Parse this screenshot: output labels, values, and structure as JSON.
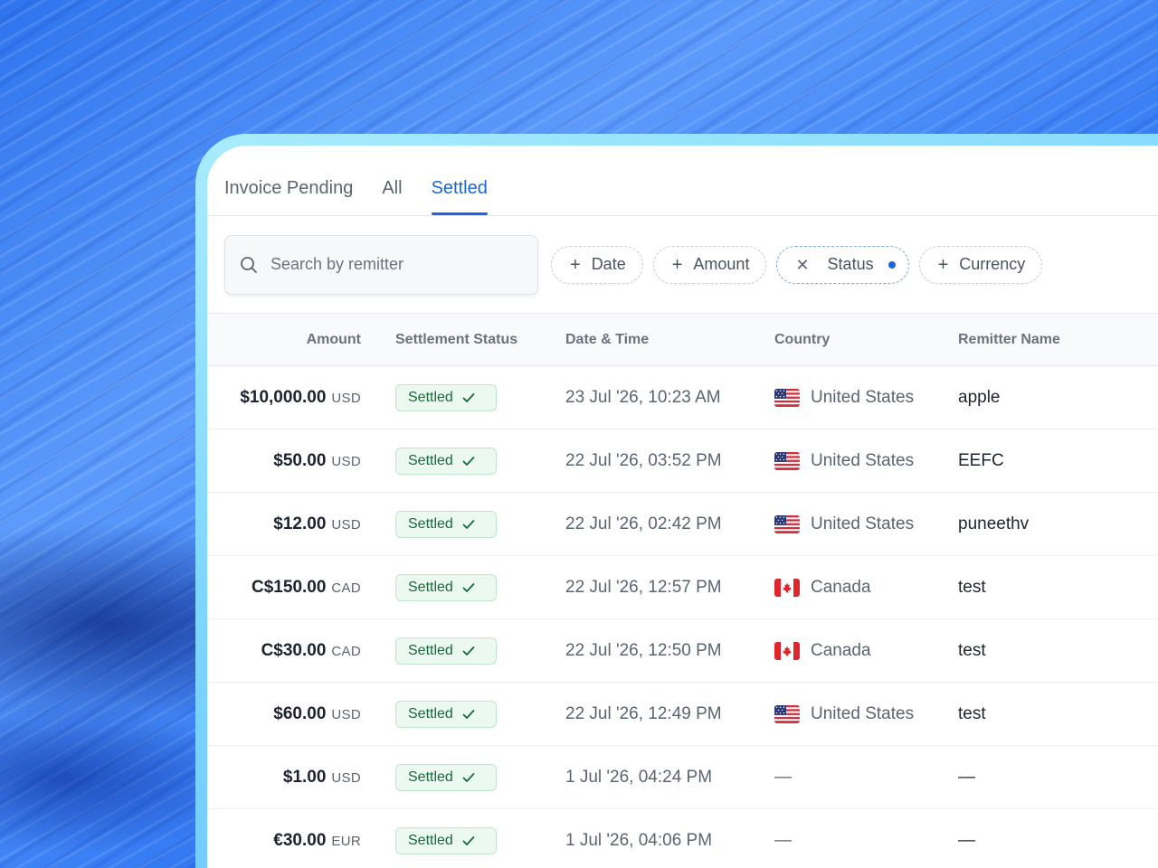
{
  "tabs": [
    {
      "label": "Invoice Pending",
      "active": false
    },
    {
      "label": "All",
      "active": false
    },
    {
      "label": "Settled",
      "active": true
    }
  ],
  "search": {
    "placeholder": "Search by remitter"
  },
  "filters": [
    {
      "label": "Date",
      "icon": "plus-icon",
      "active": false
    },
    {
      "label": "Amount",
      "icon": "plus-icon",
      "active": false
    },
    {
      "label": "Status",
      "icon": "close-icon",
      "active": true
    },
    {
      "label": "Currency",
      "icon": "plus-icon",
      "active": false
    }
  ],
  "table": {
    "headers": {
      "amount": "Amount",
      "status": "Settlement Status",
      "date": "Date & Time",
      "country": "Country",
      "remitter": "Remitter Name"
    },
    "rows": [
      {
        "amount": "$10,000.00",
        "currency": "USD",
        "status": "Settled",
        "date": "23 Jul '26, 10:23 AM",
        "country": "United States",
        "flag": "us-flag-icon",
        "remitter": "apple"
      },
      {
        "amount": "$50.00",
        "currency": "USD",
        "status": "Settled",
        "date": "22 Jul '26, 03:52 PM",
        "country": "United States",
        "flag": "us-flag-icon",
        "remitter": "EEFC"
      },
      {
        "amount": "$12.00",
        "currency": "USD",
        "status": "Settled",
        "date": "22 Jul '26, 02:42 PM",
        "country": "United States",
        "flag": "us-flag-icon",
        "remitter": "puneethv"
      },
      {
        "amount": "C$150.00",
        "currency": "CAD",
        "status": "Settled",
        "date": "22 Jul '26, 12:57 PM",
        "country": "Canada",
        "flag": "ca-flag-icon",
        "remitter": "test"
      },
      {
        "amount": "C$30.00",
        "currency": "CAD",
        "status": "Settled",
        "date": "22 Jul '26, 12:50 PM",
        "country": "Canada",
        "flag": "ca-flag-icon",
        "remitter": "test"
      },
      {
        "amount": "$60.00",
        "currency": "USD",
        "status": "Settled",
        "date": "22 Jul '26, 12:49 PM",
        "country": "United States",
        "flag": "us-flag-icon",
        "remitter": "test"
      },
      {
        "amount": "$1.00",
        "currency": "USD",
        "status": "Settled",
        "date": "1 Jul '26, 04:24 PM",
        "country": "—",
        "flag": "",
        "remitter": "—"
      },
      {
        "amount": "€30.00",
        "currency": "EUR",
        "status": "Settled",
        "date": "1 Jul '26, 04:06 PM",
        "country": "—",
        "flag": "",
        "remitter": "—"
      }
    ]
  },
  "colors": {
    "accent": "#1a66dd",
    "settled_text": "#16693a",
    "settled_bg": "#ecf9f0",
    "frame": "#7fd6ff"
  }
}
